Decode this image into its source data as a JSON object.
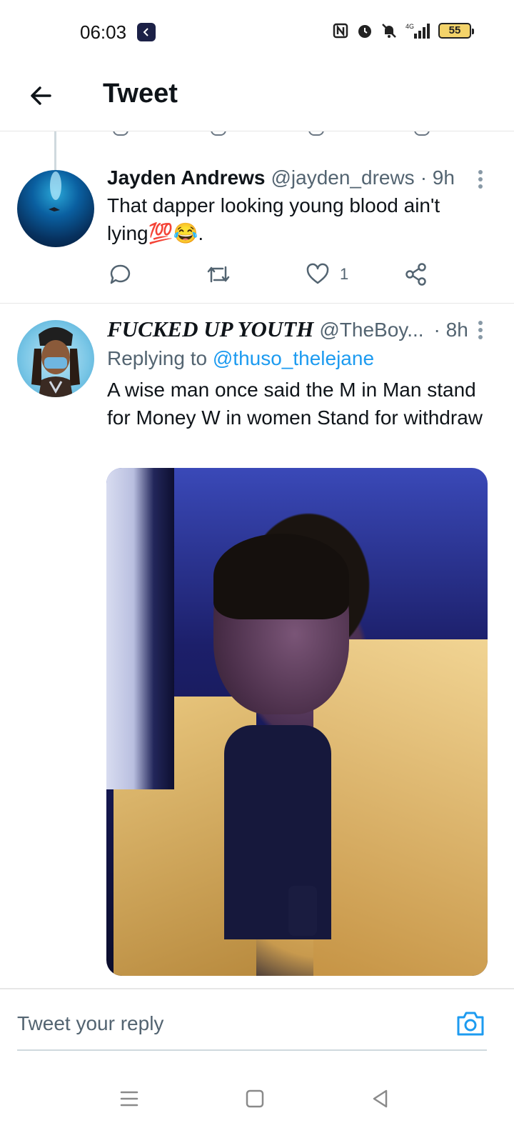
{
  "status_bar": {
    "time": "06:03",
    "network": "4G",
    "battery": "55",
    "icons": [
      "nfc-icon",
      "alarm-icon",
      "mute-icon",
      "signal-icon",
      "battery-icon"
    ]
  },
  "header": {
    "title": "Tweet",
    "back_icon": "arrow-left-icon"
  },
  "tweets": [
    {
      "name": "Jayden Andrews",
      "handle": "@jayden_drews",
      "time": "· 9h",
      "text": "That dapper looking young blood ain't lying💯😂.",
      "actions": {
        "reply_count": "",
        "retweet_count": "",
        "like_count": "1",
        "share": ""
      }
    },
    {
      "name": "FUCKED UP YOUTH",
      "handle": "@TheBoy...",
      "time": "· 8h",
      "replying_prefix": "Replying to",
      "replying_to": "@thuso_thelejane",
      "text": "A wise man once said the M in Man stand for Money W in women Stand for withdraw"
    }
  ],
  "reply_bar": {
    "placeholder": "Tweet your reply"
  },
  "colors": {
    "accent": "#1d9bf0",
    "text": "#0f1419",
    "secondary": "#536471"
  }
}
